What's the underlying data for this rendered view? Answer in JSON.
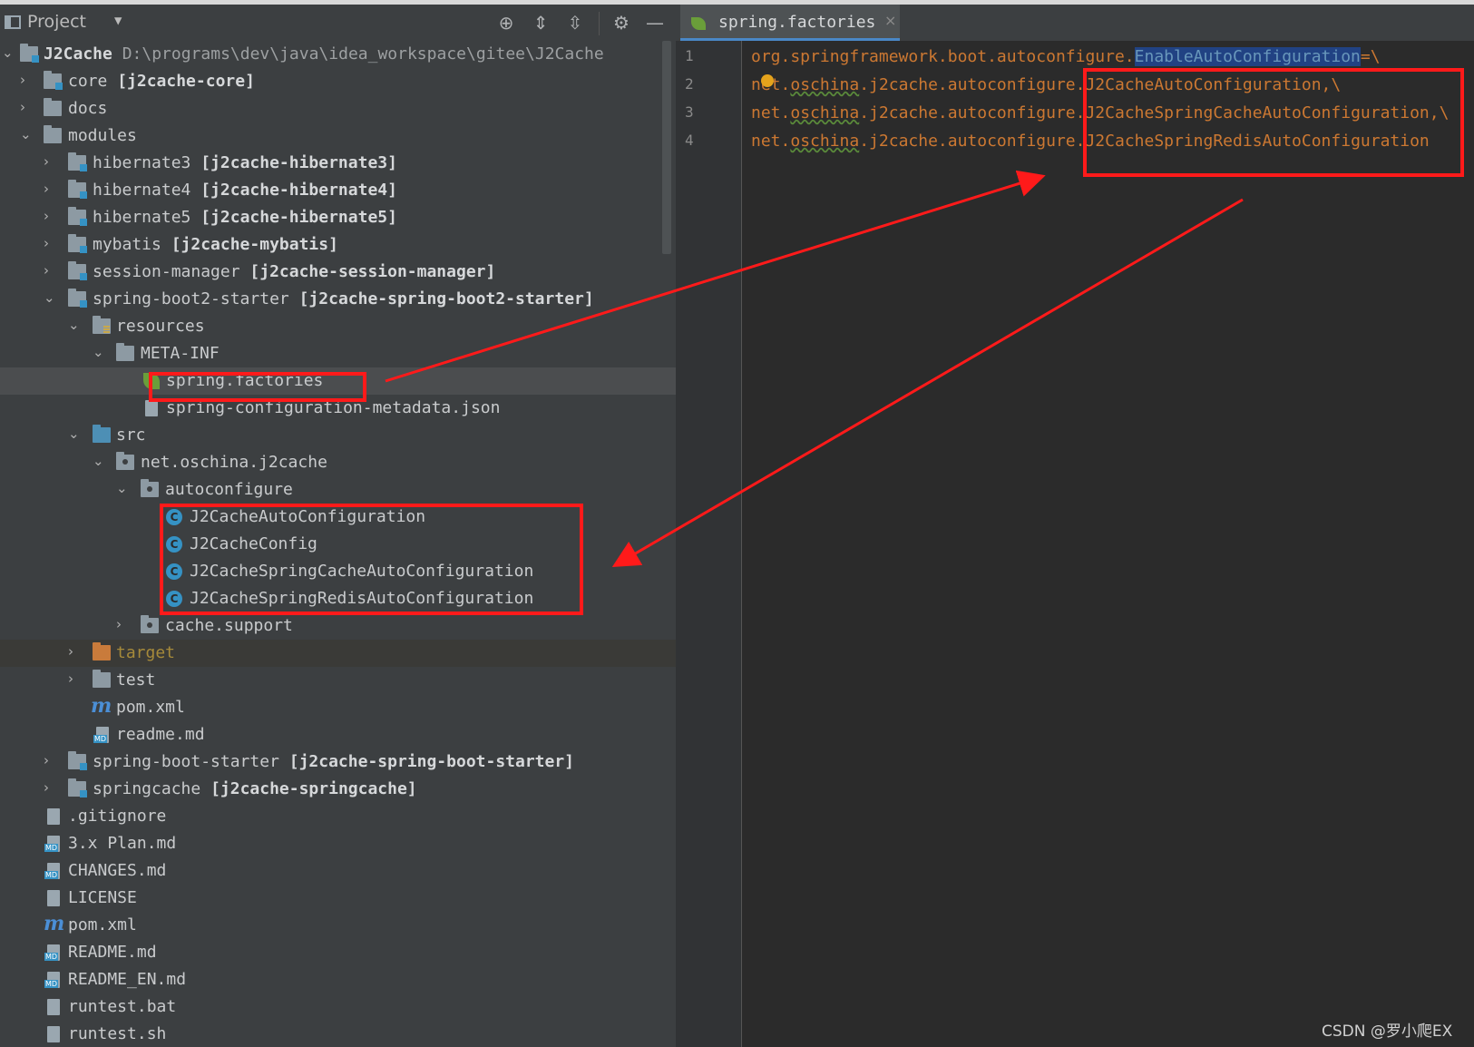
{
  "project_panel": {
    "title": "Project",
    "toolbar_icons": [
      "locate-icon",
      "expand-all-icon",
      "collapse-all-icon",
      "settings-icon",
      "hide-icon"
    ],
    "root": {
      "name": "J2Cache",
      "path": "D:\\programs\\dev\\java\\idea_workspace\\gitee\\J2Cache"
    },
    "tree": [
      {
        "label": "core",
        "module": "[j2cache-core]"
      },
      {
        "label": "docs"
      },
      {
        "label": "modules"
      },
      {
        "label": "hibernate3",
        "module": "[j2cache-hibernate3]"
      },
      {
        "label": "hibernate4",
        "module": "[j2cache-hibernate4]"
      },
      {
        "label": "hibernate5",
        "module": "[j2cache-hibernate5]"
      },
      {
        "label": "mybatis",
        "module": "[j2cache-mybatis]"
      },
      {
        "label": "session-manager",
        "module": "[j2cache-session-manager]"
      },
      {
        "label": "spring-boot2-starter",
        "module": "[j2cache-spring-boot2-starter]"
      },
      {
        "label": "resources"
      },
      {
        "label": "META-INF"
      },
      {
        "label": "spring.factories"
      },
      {
        "label": "spring-configuration-metadata.json"
      },
      {
        "label": "src"
      },
      {
        "label": "net.oschina.j2cache"
      },
      {
        "label": "autoconfigure"
      },
      {
        "label": "J2CacheAutoConfiguration"
      },
      {
        "label": "J2CacheConfig"
      },
      {
        "label": "J2CacheSpringCacheAutoConfiguration"
      },
      {
        "label": "J2CacheSpringRedisAutoConfiguration"
      },
      {
        "label": "cache.support"
      },
      {
        "label": "target"
      },
      {
        "label": "test"
      },
      {
        "label": "pom.xml"
      },
      {
        "label": "readme.md"
      },
      {
        "label": "spring-boot-starter",
        "module": "[j2cache-spring-boot-starter]"
      },
      {
        "label": "springcache",
        "module": "[j2cache-springcache]"
      },
      {
        "label": ".gitignore"
      },
      {
        "label": "3.x Plan.md"
      },
      {
        "label": "CHANGES.md"
      },
      {
        "label": "LICENSE"
      },
      {
        "label": "pom.xml"
      },
      {
        "label": "README.md"
      },
      {
        "label": "README_EN.md"
      },
      {
        "label": "runtest.bat"
      },
      {
        "label": "runtest.sh"
      }
    ]
  },
  "editor": {
    "tab": {
      "name": "spring.factories",
      "close": "×"
    },
    "lines": [
      {
        "num": "1",
        "prefix": "org.springframework.boot.autoconfigure.",
        "key": "EnableAutoConfiguration",
        "suffix": "=\\"
      },
      {
        "num": "2",
        "pkg1": "net.",
        "pkg2": "oschina",
        "pkg3": ".j2cache.autoconfigure.",
        "cls": "J2CacheAutoConfiguration,\\"
      },
      {
        "num": "3",
        "pkg1": "net.",
        "pkg2": "oschina",
        "pkg3": ".j2cache.autoconfigure.",
        "cls": "J2CacheSpringCacheAutoConfiguration,\\"
      },
      {
        "num": "4",
        "pkg1": "net.",
        "pkg2": "oschina",
        "pkg3": ".j2cache.autoconfigure.",
        "cls": "J2CacheSpringRedisAutoConfiguration"
      }
    ]
  },
  "watermark": "CSDN @罗小爬EX",
  "colors": {
    "annotation": "#ff1a1a",
    "keyword_orange": "#cc7832",
    "selection_blue": "#214283"
  }
}
